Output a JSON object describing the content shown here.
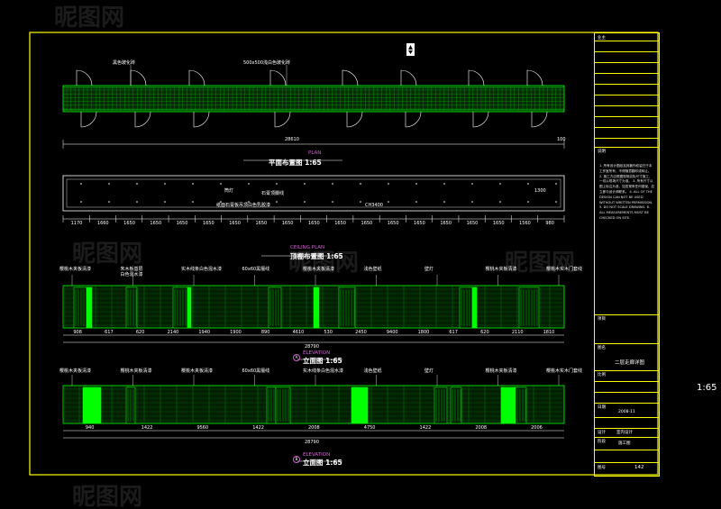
{
  "watermark": "昵图网",
  "side_scale": "1:65",
  "plan": {
    "label_dark_tile": "黑色玻化砖",
    "label_tile": "500x500浅白色玻化砖",
    "subtitle": "PLAN",
    "title": "平面布置图 1:65",
    "dims": [
      "28610",
      "100"
    ]
  },
  "ceiling": {
    "label_lamp": "筒灯",
    "label_gypsum_line": "石膏顶脚线",
    "label_board": "纸面石膏板吊顶白色乳胶漆",
    "label_height": "CH3400",
    "label_dim_1300": "1300",
    "subtitle": "CEILING PLAN",
    "title": "顶棚布置图 1:65",
    "dims": [
      "1170",
      "1660",
      "1650",
      "1650",
      "1650",
      "1650",
      "1650",
      "1650",
      "1650",
      "1650",
      "1650",
      "1650",
      "1650",
      "1650",
      "1650",
      "1650",
      "1650",
      "1560",
      "980"
    ]
  },
  "elev1": {
    "labels": [
      "樱桃木夹板清漆",
      "朱木板基层\n白色混水漆",
      "实木线条白色混水漆",
      "60x60黑檀线",
      "樱桃木夹板清漆",
      "浅色壁纸",
      "壁灯",
      "樱桃木夹板清漆",
      "樱桃木实木门套线"
    ],
    "subtitle": "ELEVATION",
    "title": "立面图 1:65",
    "marker": "A",
    "dims": [
      "908",
      "617",
      "620",
      "2140",
      "1940",
      "1900",
      "890",
      "4610",
      "530",
      "2450",
      "9400",
      "1800",
      "617",
      "620",
      "2110",
      "1810"
    ],
    "total": "28790"
  },
  "elev2": {
    "labels": [
      "樱桃木夹板清漆",
      "樱桃木夹板清漆",
      "樱桃木夹板清漆",
      "60x60黑檀线",
      "实木线条白色混水漆",
      "浅色壁纸",
      "壁灯",
      "樱桃木夹板清漆",
      "樱桃木实木门套线"
    ],
    "subtitle": "ELEVATION",
    "title": "立面图 1:65",
    "marker": "B",
    "dims": [
      "940",
      "1422",
      "9560",
      "1422",
      "2008",
      "4750",
      "1422",
      "2008",
      "2006"
    ],
    "total": "28790"
  },
  "titleblock": {
    "owner_label": "业主",
    "notes_label": "说明",
    "notes": "1. 所有设计图纸及其著作权皆归于本工作室所有，不得随意翻印或转让。 2. 施工方应根据现场实际尺寸施工，一切以现场尺寸为准。 3. 所有尺寸以图上标注为准，如发现有任何错误，应立即与设计师联系。 4. ALL OF THE DESIGN CAN NOT BE USED WITHOUT WRITTEN PERMISSION. 5. DO NOT SCALE DRAWING. 6. ALL MEASUREMENTS MUST BE CHECKED ON SITE.",
    "project_label": "项目",
    "drawing_label": "图名",
    "drawing_name": "二层走廊详图",
    "scale_label": "比例",
    "date_label": "日期",
    "date": "2008-11",
    "design_label": "设计",
    "design_value": "室内设计",
    "stage_label": "阶段",
    "stage_value": "施工图",
    "number_label": "图号",
    "number_value": "142"
  },
  "colors": {
    "green": "#00ff00",
    "frame": "#ffff00",
    "accent": "#d060d0"
  }
}
